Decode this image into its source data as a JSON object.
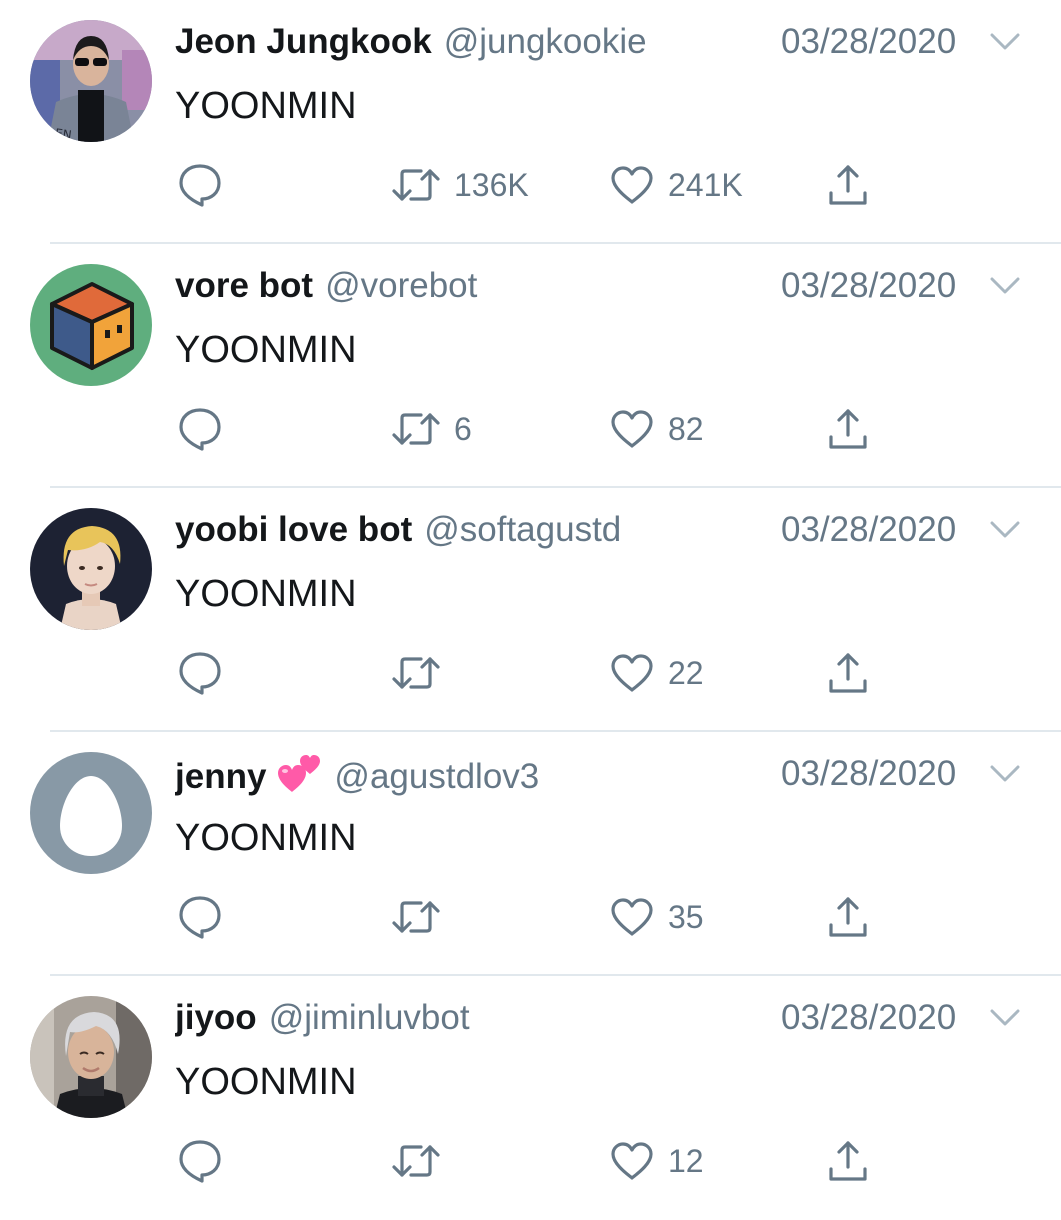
{
  "tweets": [
    {
      "display_name": "Jeon Jungkook",
      "handle": "@jungkookie",
      "date": "03/28/2020",
      "text": "YOONMIN",
      "retweets": "136K",
      "likes": "241K",
      "avatar": "photo-jungkook",
      "avatar_text": "LEN",
      "emoji": ""
    },
    {
      "display_name": "vore bot",
      "handle": "@vorebot",
      "date": "03/28/2020",
      "text": "YOONMIN",
      "retweets": "6",
      "likes": "82",
      "avatar": "cube-icon",
      "emoji": ""
    },
    {
      "display_name": "yoobi love bot",
      "handle": "@softagustd",
      "date": "03/28/2020",
      "text": "YOONMIN",
      "retweets": "",
      "likes": "22",
      "avatar": "photo-blonde",
      "emoji": ""
    },
    {
      "display_name": "jenny",
      "handle": "@agustdlov3",
      "date": "03/28/2020",
      "text": "YOONMIN",
      "retweets": "",
      "likes": "35",
      "avatar": "egg-icon",
      "emoji": "two-hearts-emoji"
    },
    {
      "display_name": "jiyoo",
      "handle": "@jiminluvbot",
      "date": "03/28/2020",
      "text": "YOONMIN",
      "retweets": "",
      "likes": "12",
      "avatar": "photo-silver-hair",
      "emoji": ""
    }
  ],
  "colors": {
    "text_primary": "#14171a",
    "text_secondary": "#657786",
    "divider": "#e1e8ed",
    "egg_avatar_bg": "#8899a6",
    "cube_avatar_bg": "#5fae7e",
    "emoji_pink": "#ff5aa8"
  },
  "icons": {
    "reply": "reply-icon",
    "retweet": "retweet-icon",
    "like": "heart-icon",
    "share": "share-icon",
    "menu": "chevron-down-icon"
  }
}
